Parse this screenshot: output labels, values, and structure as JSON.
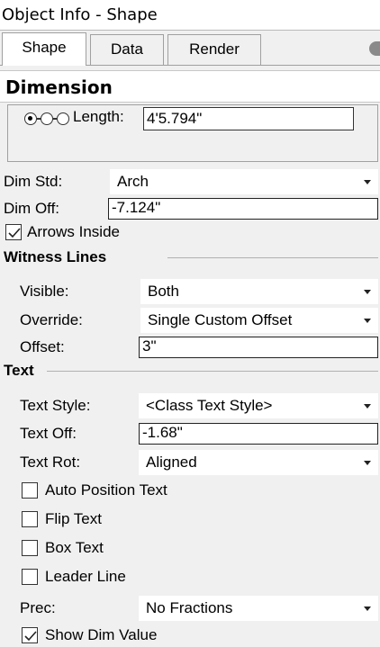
{
  "window": {
    "title": "Object Info - Shape"
  },
  "tabs": [
    {
      "label": "Shape",
      "active": true
    },
    {
      "label": "Data",
      "active": false
    },
    {
      "label": "Render",
      "active": false
    }
  ],
  "section": {
    "title": "Dimension"
  },
  "dimension": {
    "length_label": "Length:",
    "length_value": "4'5.794\""
  },
  "dim_std": {
    "label": "Dim Std:",
    "value": "Arch"
  },
  "dim_off": {
    "label": "Dim Off:",
    "value": "-7.124\""
  },
  "arrows_inside": {
    "label": "Arrows Inside",
    "checked": true
  },
  "witness": {
    "heading": "Witness Lines",
    "visible": {
      "label": "Visible:",
      "value": "Both"
    },
    "override": {
      "label": "Override:",
      "value": "Single Custom Offset"
    },
    "offset": {
      "label": "Offset:",
      "value": "3\""
    }
  },
  "text": {
    "heading": "Text",
    "style": {
      "label": "Text Style:",
      "value": "<Class Text Style>"
    },
    "offset": {
      "label": "Text Off:",
      "value": "-1.68\""
    },
    "rotation": {
      "label": "Text Rot:",
      "value": "Aligned"
    },
    "auto_position": {
      "label": "Auto Position Text",
      "checked": false
    },
    "flip": {
      "label": "Flip Text",
      "checked": false
    },
    "box": {
      "label": "Box Text",
      "checked": false
    },
    "leader": {
      "label": "Leader Line",
      "checked": false
    },
    "prec": {
      "label": "Prec:",
      "value": "No Fractions"
    },
    "show_dim_value": {
      "label": "Show Dim Value",
      "checked": true
    }
  },
  "icons": {
    "radio_selected": "radio-selected",
    "radio_unselected": "radio-unselected",
    "dropdown": "chevron-down",
    "checkmark": "check"
  }
}
